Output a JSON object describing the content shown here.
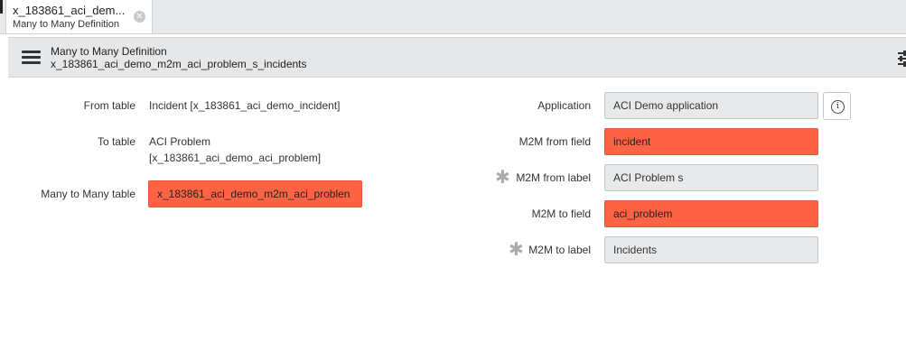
{
  "tab": {
    "title": "x_183861_aci_dem...",
    "subtitle": "Many to Many Definition",
    "close_icon": "close-icon"
  },
  "header": {
    "title": "Many to Many Definition",
    "subtitle": "x_183861_aci_demo_m2m_aci_problem_s_incidents",
    "menu_icon": "hamburger-icon",
    "settings_icon": "sliders-icon"
  },
  "form": {
    "from_table": {
      "label": "From table",
      "value": "Incident [x_183861_aci_demo_incident]"
    },
    "to_table": {
      "label": "To table",
      "value_line1": "ACI Problem",
      "value_line2": "[x_183861_aci_demo_aci_problem]"
    },
    "many_to_many_table": {
      "label": "Many to Many table",
      "value": "x_183861_aci_demo_m2m_aci_problen"
    },
    "application": {
      "label": "Application",
      "value": "ACI Demo application",
      "info_icon": "info-icon"
    },
    "m2m_from_field": {
      "label": "M2M from field",
      "value": "incident"
    },
    "m2m_from_label": {
      "label": "M2M from label",
      "value": "ACI Problem s",
      "mandatory": "✱"
    },
    "m2m_to_field": {
      "label": "M2M to field",
      "value": "aci_problem"
    },
    "m2m_to_label": {
      "label": "M2M to label",
      "value": "Incidents",
      "mandatory": "✱"
    }
  },
  "colors": {
    "error_field": "#ff6344",
    "readonly_field": "#e8e9ea",
    "header_bg": "#e6e7e8"
  }
}
